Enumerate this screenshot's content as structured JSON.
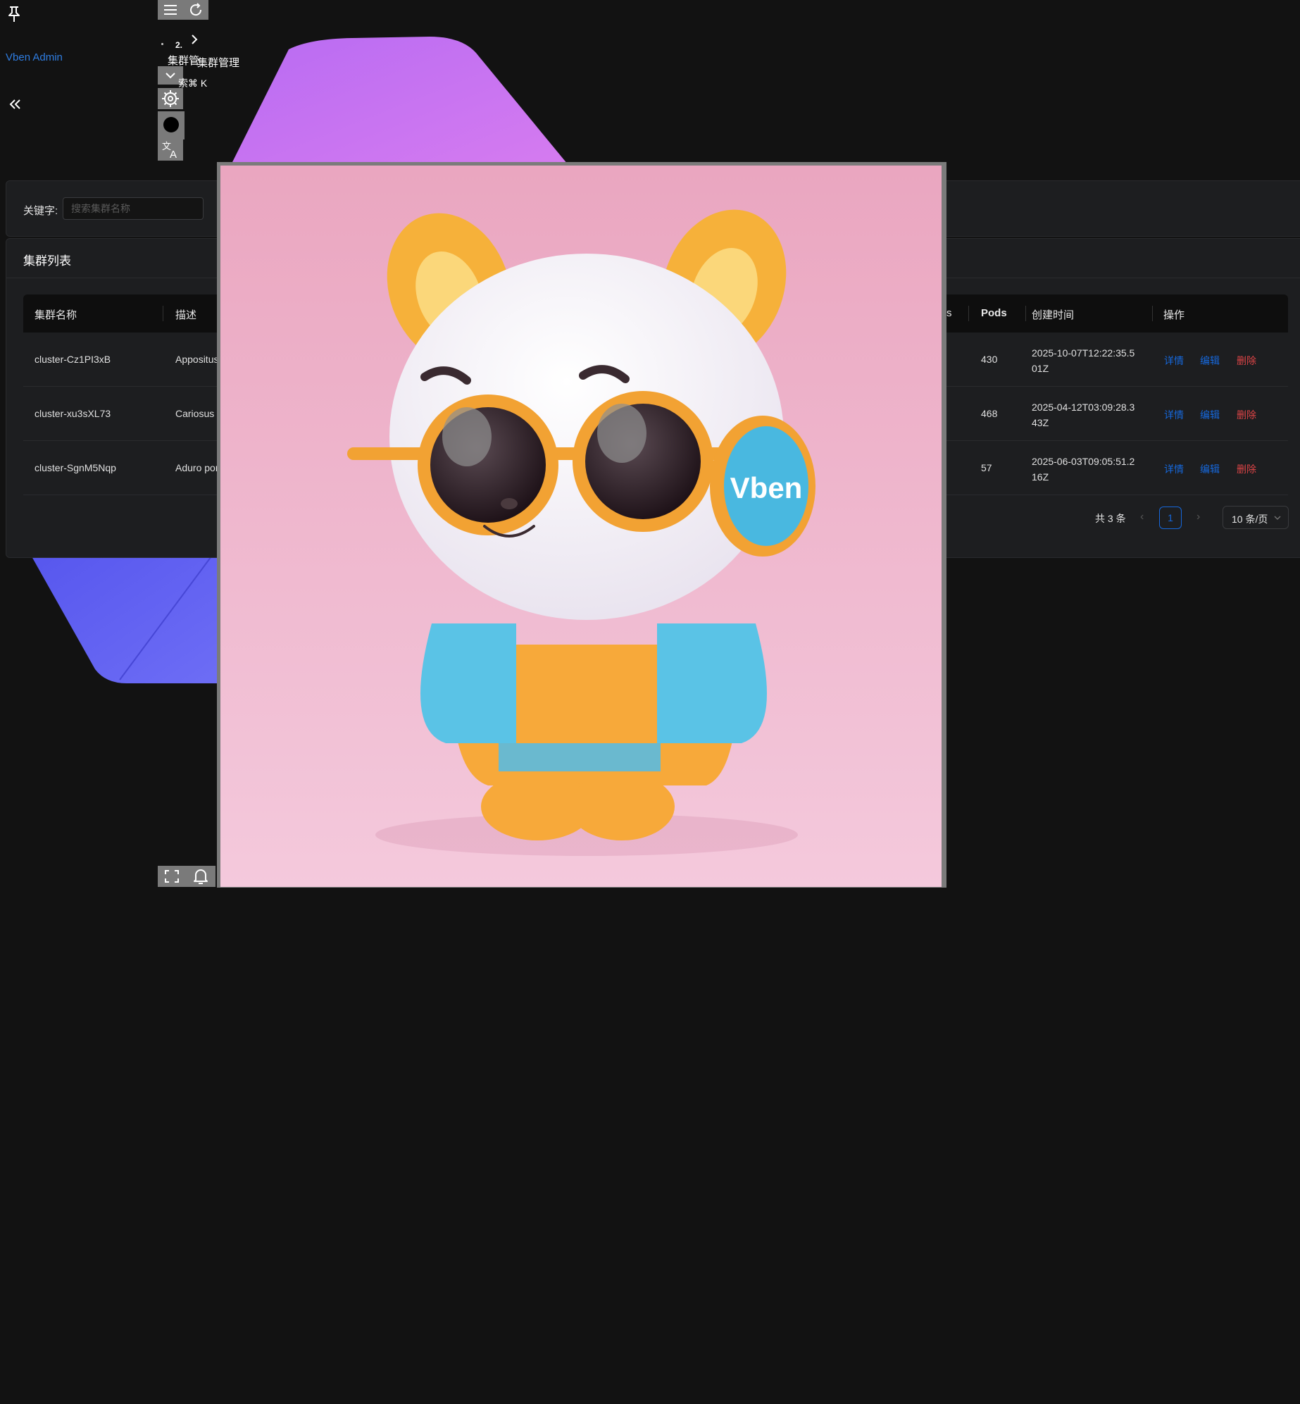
{
  "sidebar": {
    "brand": "Vben Admin",
    "icons": {
      "pin": "pin-icon",
      "collapse": "double-chevron-left-icon"
    }
  },
  "header": {
    "breadcrumb": {
      "index": "2.",
      "item_a": "集群管",
      "item_b": "集群管理"
    },
    "search_hint": "索⌘ K",
    "icons": [
      "menu-icon",
      "refresh-icon",
      "chevron-down-icon",
      "settings-icon",
      "theme-toggle-icon",
      "translate-icon",
      "fullscreen-icon",
      "bell-icon"
    ]
  },
  "filter": {
    "label": "关键字:",
    "placeholder": "搜索集群名称",
    "value": ""
  },
  "list": {
    "title": "集群列表",
    "columns": {
      "name": "集群名称",
      "desc": "描述",
      "pods_partial": "s",
      "pods": "Pods",
      "created": "创建时间",
      "actions": "操作"
    },
    "rows": [
      {
        "name": "cluster-Cz1PI3xB",
        "desc": "Appositus",
        "pods": "430",
        "created": "2025-10-07T12:22:35.501Z"
      },
      {
        "name": "cluster-xu3sXL73",
        "desc": "Cariosus",
        "pods": "468",
        "created": "2025-04-12T03:09:28.343Z"
      },
      {
        "name": "cluster-SgnM5Nqp",
        "desc": "Aduro por",
        "pods": "57",
        "created": "2025-06-03T09:05:51.216Z"
      }
    ],
    "actions": {
      "detail": "详情",
      "edit": "编辑",
      "delete": "删除"
    }
  },
  "pagination": {
    "total": "共 3 条",
    "current_page": "1",
    "page_size": "10 条/页"
  },
  "overlay": {
    "badge_text": "Vben",
    "description_name": "mascot-image"
  },
  "colors": {
    "background": "#121212",
    "card": "#1d1e20",
    "primary": "#1668dc",
    "danger": "#dc4446",
    "brand_link": "#2f7de1"
  }
}
